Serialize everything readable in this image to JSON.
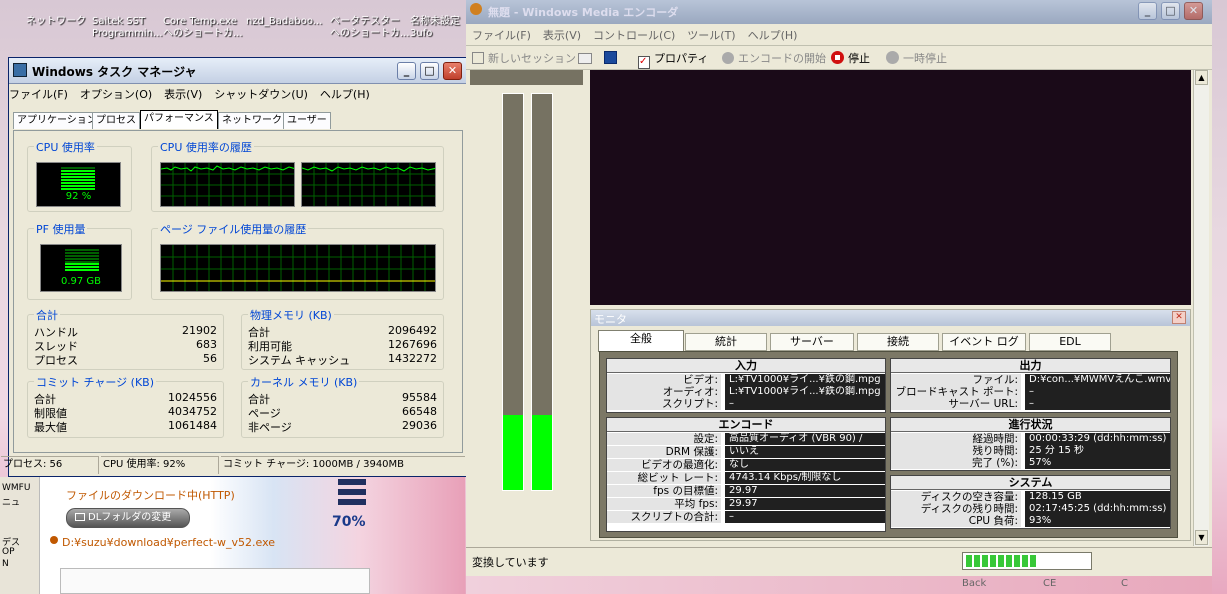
{
  "desktop": {
    "icons": [
      {
        "line1": "ネットワーク",
        "line2": ""
      },
      {
        "line1": "Saitek SST",
        "line2": "Programmin..."
      },
      {
        "line1": "Core Temp.exe",
        "line2": "へのショートカ..."
      },
      {
        "line1": "nzd_Badaboo...",
        "line2": ""
      },
      {
        "line1": "ベータテスター",
        "line2": "へのショートカ..."
      },
      {
        "line1": "名称未設定",
        "line2": "3ufo"
      }
    ]
  },
  "taskmgr": {
    "title": "Windows タスク マネージャ",
    "menu": [
      "ファイル(F)",
      "オプション(O)",
      "表示(V)",
      "シャットダウン(U)",
      "ヘルプ(H)"
    ],
    "tabs": [
      "アプリケーション",
      "プロセス",
      "パフォーマンス",
      "ネットワーク",
      "ユーザー"
    ],
    "active_tab": "パフォーマンス",
    "cpu_usage_label": "CPU 使用率",
    "cpu_usage_value": "92 %",
    "cpu_usage_percent": 92,
    "cpu_history_label": "CPU 使用率の履歴",
    "pf_usage_label": "PF 使用量",
    "pf_usage_value": "0.97 GB",
    "pf_history_label": "ページ ファイル使用量の履歴",
    "totals": {
      "label": "合計",
      "rows": [
        {
          "k": "ハンドル",
          "v": "21902"
        },
        {
          "k": "スレッド",
          "v": "683"
        },
        {
          "k": "プロセス",
          "v": "56"
        }
      ]
    },
    "physical": {
      "label": "物理メモリ (KB)",
      "rows": [
        {
          "k": "合計",
          "v": "2096492"
        },
        {
          "k": "利用可能",
          "v": "1267696"
        },
        {
          "k": "システム キャッシュ",
          "v": "1432272"
        }
      ]
    },
    "commit": {
      "label": "コミット チャージ (KB)",
      "rows": [
        {
          "k": "合計",
          "v": "1024556"
        },
        {
          "k": "制限値",
          "v": "4034752"
        },
        {
          "k": "最大値",
          "v": "1061484"
        }
      ]
    },
    "kernel": {
      "label": "カーネル メモリ (KB)",
      "rows": [
        {
          "k": "合計",
          "v": "95584"
        },
        {
          "k": "ページ",
          "v": "66548"
        },
        {
          "k": "非ページ",
          "v": "29036"
        }
      ]
    },
    "status": {
      "processes": "プロセス: 56",
      "cpu": "CPU 使用率: 92%",
      "commit": "コミット チャージ: 1000MB / 3940MB"
    }
  },
  "download": {
    "status": "ファイルのダウンロード中(HTTP)",
    "folder_button": "DLフォルダの変更",
    "percent": "70%",
    "path": "D:¥suzu¥download¥perfect-w_v52.exe",
    "side_labels": [
      "WMFU",
      "ニュ",
      "デス",
      "OP",
      "N"
    ]
  },
  "wme": {
    "title": "無題 - Windows Media エンコーダ",
    "menu": [
      "ファイル(F)",
      "表示(V)",
      "コントロール(C)",
      "ツール(T)",
      "ヘルプ(H)"
    ],
    "toolbar": {
      "new_session": "新しいセッション",
      "properties": "プロパティ",
      "start_encoding": "エンコードの開始",
      "stop": "停止",
      "pause": "一時停止"
    },
    "level_meters": [
      0.19,
      0.19
    ],
    "monitor": {
      "title": "モニタ",
      "tabs": [
        "全般",
        "統計",
        "サーバー",
        "接続",
        "イベント ログ",
        "EDL"
      ],
      "active_tab": "全般",
      "input": {
        "header": "入力",
        "rows": [
          {
            "k": "ビデオ:",
            "v": "L:¥TV1000¥ライ...¥鉄の鋼.mpg"
          },
          {
            "k": "オーディオ:",
            "v": "L:¥TV1000¥ライ...¥鉄の鋼.mpg"
          },
          {
            "k": "スクリプト:",
            "v": "–"
          }
        ]
      },
      "output": {
        "header": "出力",
        "rows": [
          {
            "k": "ファイル:",
            "v": "D:¥con...¥MWMVえんこ.wmv"
          },
          {
            "k": "ブロードキャスト ポート:",
            "v": "–"
          },
          {
            "k": "サーバー URL:",
            "v": "–"
          }
        ]
      },
      "encode": {
        "header": "エンコード",
        "rows": [
          {
            "k": "設定:",
            "v": "高品質オーディオ (VBR 90) /"
          },
          {
            "k": "DRM 保護:",
            "v": "いいえ"
          },
          {
            "k": "ビデオの最適化:",
            "v": "なし"
          },
          {
            "k": "総ビット レート:",
            "v": "4743.14 Kbps/制限なし"
          },
          {
            "k": "fps の目標値:",
            "v": "29.97"
          },
          {
            "k": "平均 fps:",
            "v": "29.97"
          },
          {
            "k": "スクリプトの合計:",
            "v": "–"
          }
        ]
      },
      "progress": {
        "header": "進行状況",
        "rows": [
          {
            "k": "経過時間:",
            "v": "00:00:33:29 (dd:hh:mm:ss)"
          },
          {
            "k": "残り時間:",
            "v": "25 分 15 秒"
          },
          {
            "k": "完了 (%):",
            "v": "57%"
          }
        ]
      },
      "system": {
        "header": "システム",
        "rows": [
          {
            "k": "ディスクの空き容量:",
            "v": "128.15 GB"
          },
          {
            "k": "ディスクの残り時間:",
            "v": "02:17:45:25 (dd:hh:mm:ss)"
          },
          {
            "k": "CPU 負荷:",
            "v": "93%"
          }
        ]
      }
    },
    "status_text": "変換しています",
    "progress_fraction": 0.57,
    "bottom_buttons": [
      "Back",
      "CE",
      "C"
    ]
  }
}
